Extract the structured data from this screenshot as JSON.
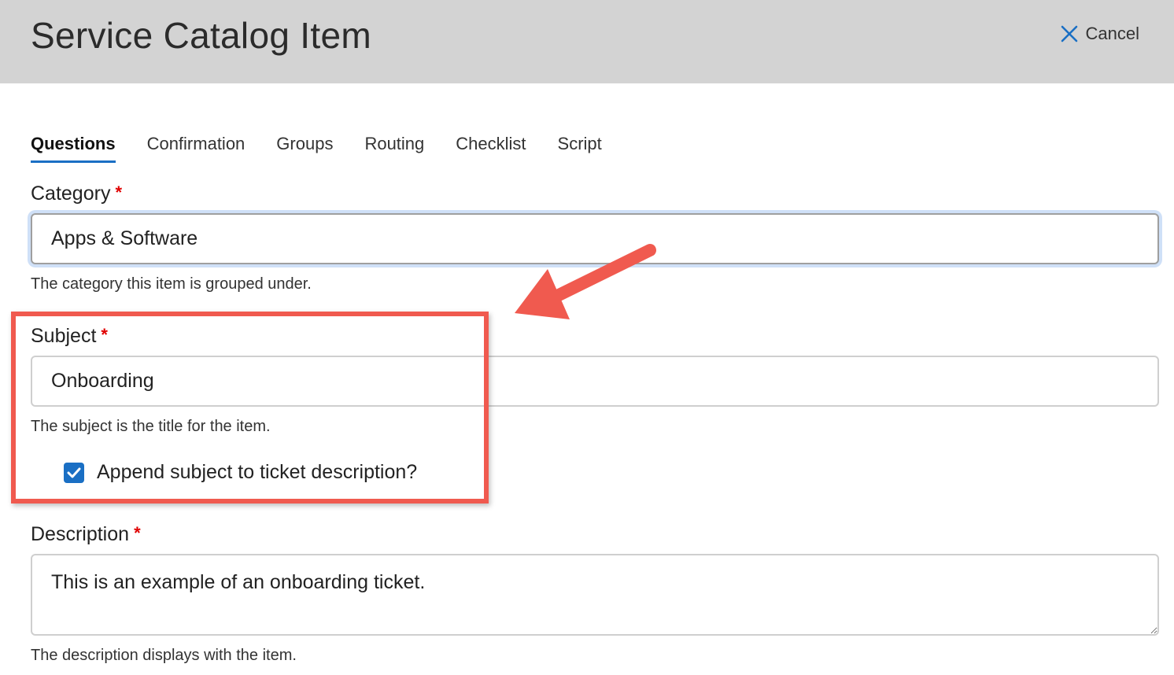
{
  "header": {
    "title": "Service Catalog Item",
    "cancel_label": "Cancel"
  },
  "tabs": [
    {
      "label": "Questions",
      "active": true
    },
    {
      "label": "Confirmation",
      "active": false
    },
    {
      "label": "Groups",
      "active": false
    },
    {
      "label": "Routing",
      "active": false
    },
    {
      "label": "Checklist",
      "active": false
    },
    {
      "label": "Script",
      "active": false
    }
  ],
  "form": {
    "category": {
      "label": "Category",
      "required_mark": "*",
      "value": "Apps & Software",
      "help": "The category this item is grouped under."
    },
    "subject": {
      "label": "Subject",
      "required_mark": "*",
      "value": "Onboarding",
      "help": "The subject is the title for the item."
    },
    "append_subject": {
      "label": "Append subject to ticket description?",
      "checked": true
    },
    "description": {
      "label": "Description",
      "required_mark": "*",
      "value": "This is an example of an onboarding ticket.",
      "help": "The description displays with the item."
    }
  },
  "colors": {
    "accent": "#1a6fc4",
    "annotation": "#f05a4f",
    "header_bg": "#d3d3d3",
    "required": "#e00000"
  }
}
